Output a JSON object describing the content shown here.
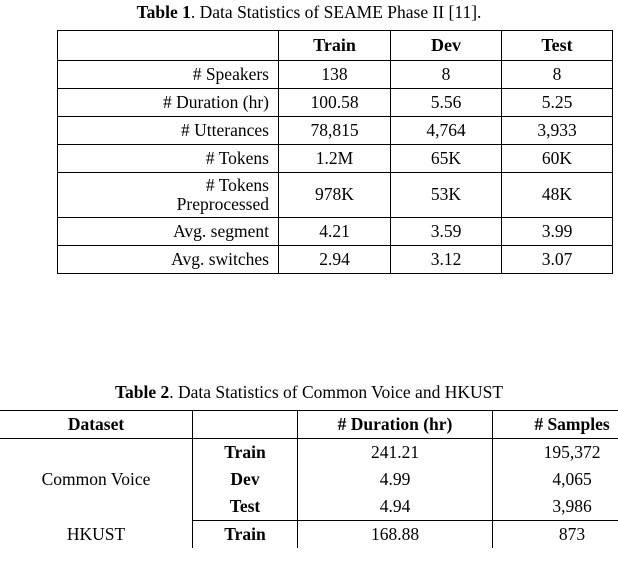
{
  "table1": {
    "caption_label": "Table 1",
    "caption_text": ". Data Statistics of SEAME Phase II [11].",
    "headers": [
      "",
      "Train",
      "Dev",
      "Test"
    ],
    "rows": [
      {
        "label": "# Speakers",
        "values": [
          "138",
          "8",
          "8"
        ]
      },
      {
        "label": "# Duration (hr)",
        "values": [
          "100.58",
          "5.56",
          "5.25"
        ]
      },
      {
        "label": "# Utterances",
        "values": [
          "78,815",
          "4,764",
          "3,933"
        ]
      },
      {
        "label": "# Tokens",
        "values": [
          "1.2M",
          "65K",
          "60K"
        ]
      },
      {
        "label": "# Tokens\nPreprocessed",
        "label_line1": "# Tokens",
        "label_line2": "Preprocessed",
        "values": [
          "978K",
          "53K",
          "48K"
        ]
      },
      {
        "label": "Avg. segment",
        "values": [
          "4.21",
          "3.59",
          "3.99"
        ]
      },
      {
        "label": "Avg. switches",
        "values": [
          "2.94",
          "3.12",
          "3.07"
        ]
      }
    ]
  },
  "table2": {
    "caption_label": "Table 2",
    "caption_text": ". Data Statistics of Common Voice and HKUST",
    "headers": [
      "Dataset",
      "",
      "# Duration (hr)",
      "# Samples"
    ],
    "groups": [
      {
        "name": "Common Voice",
        "rows": [
          {
            "split": "Train",
            "duration": "241.21",
            "samples": "195,372"
          },
          {
            "split": "Dev",
            "duration": "4.99",
            "samples": "4,065"
          },
          {
            "split": "Test",
            "duration": "4.94",
            "samples": "3,986"
          }
        ]
      },
      {
        "name": "HKUST",
        "rows": [
          {
            "split": "Train",
            "duration": "168.88",
            "samples": "873"
          }
        ]
      }
    ]
  }
}
